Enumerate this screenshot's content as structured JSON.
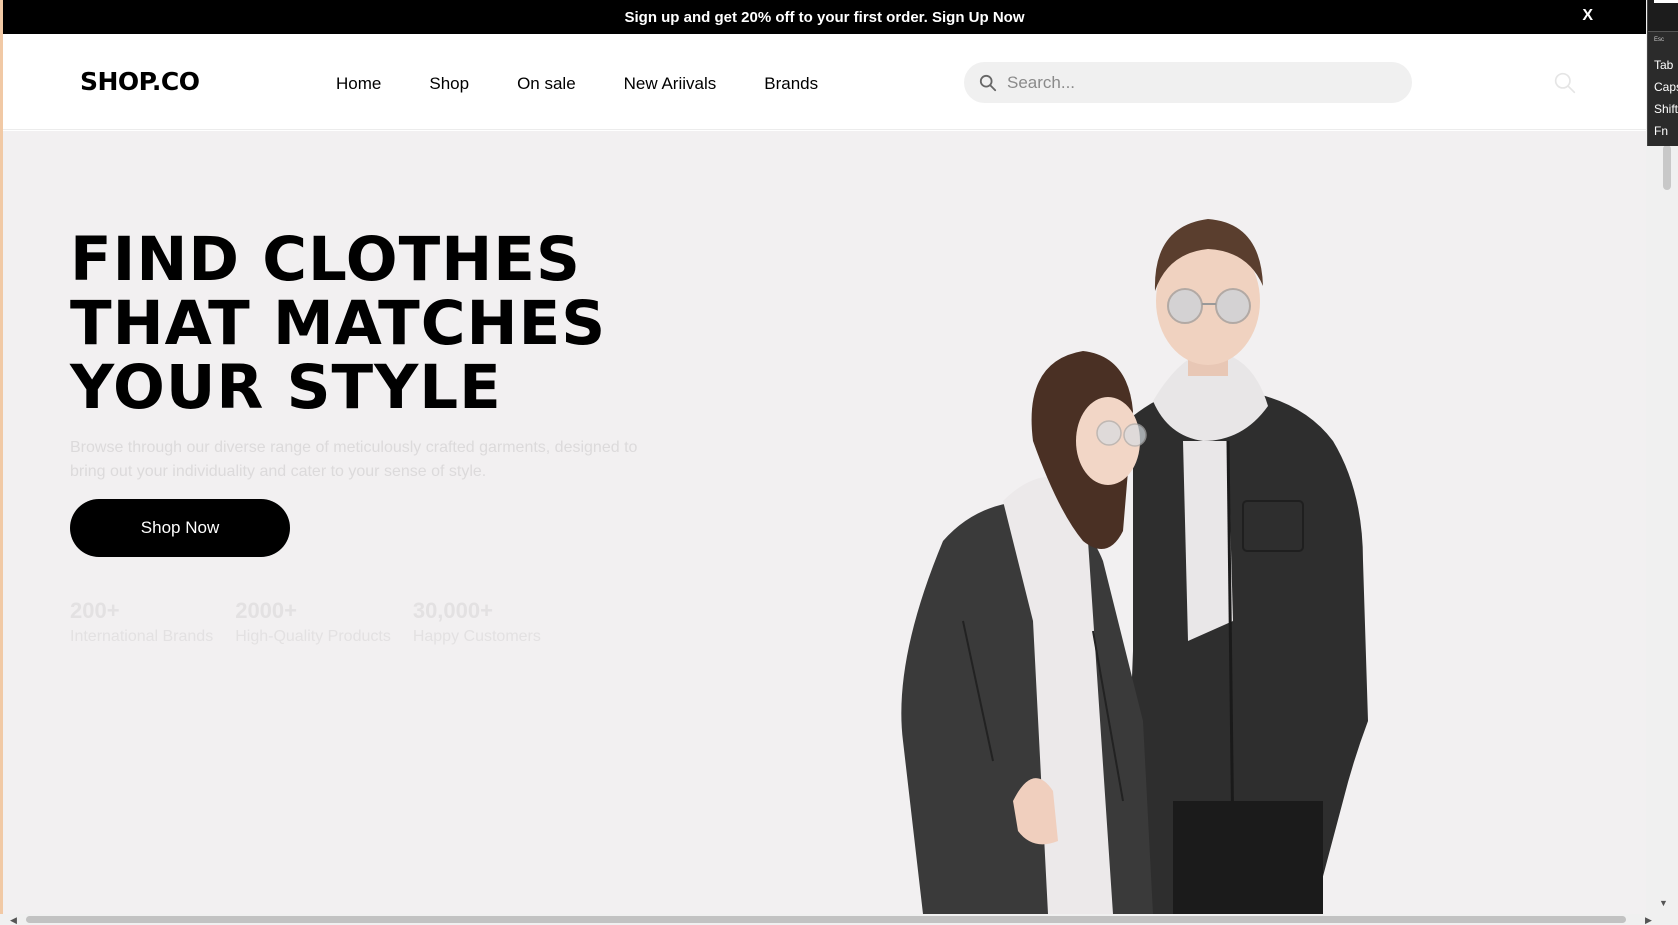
{
  "promo": {
    "text": "Sign up and get 20% off to your first order. Sign Up Now",
    "close_label": "X"
  },
  "header": {
    "logo": "SHOP.CO",
    "nav": [
      "Home",
      "Shop",
      "On sale",
      "New Ariivals",
      "Brands"
    ],
    "search": {
      "placeholder": "Search...",
      "value": ""
    }
  },
  "hero": {
    "title_lines": [
      "FIND CLOTHES",
      "THAT MATCHES",
      "YOUR STYLE"
    ],
    "description": "Browse through our diverse range of meticulously crafted garments, designed to bring out your individuality and cater to your sense of style.",
    "cta_label": "Shop Now",
    "stats": [
      {
        "value": "200+",
        "label": "International Brands"
      },
      {
        "value": "2000+",
        "label": "High-Quality Products"
      },
      {
        "value": "30,000+",
        "label": "Happy Customers"
      }
    ]
  },
  "keyboard": {
    "keys": [
      "Esc",
      "Tab",
      "Caps",
      "Shift",
      "Fn"
    ]
  },
  "icons": {
    "search": "search-icon",
    "close": "close-icon"
  },
  "colors": {
    "promo_bg": "#000000",
    "hero_bg": "#f2f0f1",
    "search_bg": "#f0f0f0",
    "button_bg": "#000000"
  }
}
